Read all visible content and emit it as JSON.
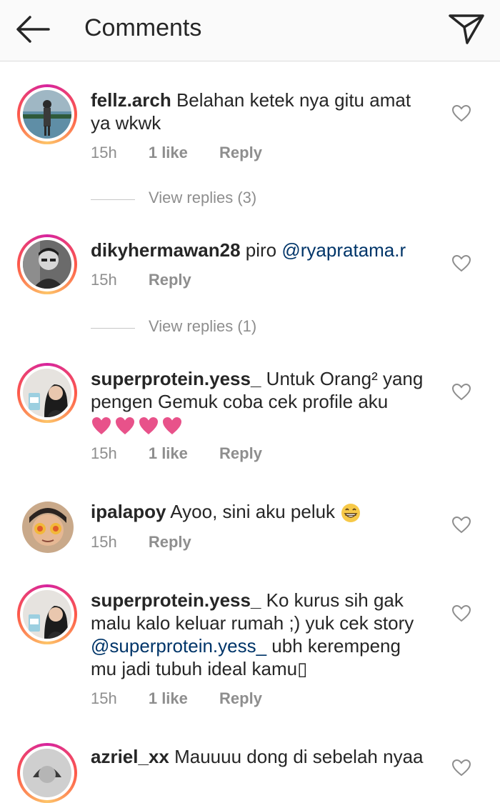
{
  "header": {
    "title": "Comments"
  },
  "comments": [
    {
      "username": "fellz.arch",
      "text_line1": " Belahan ketek nya gitu amat",
      "text_line2": "ya wkwk",
      "time": "15h",
      "likes": "1 like",
      "reply_label": "Reply",
      "view_replies": "View replies (3)"
    },
    {
      "username": "dikyhermawan28",
      "text": " piro ",
      "mention": "@ryapratama.r",
      "time": "15h",
      "reply_label": "Reply",
      "view_replies": "View replies (1)"
    },
    {
      "username": "superprotein.yess_",
      "text_line1": " Untuk Orang² yang",
      "text_line2": "pengen Gemuk coba cek profile aku",
      "time": "15h",
      "likes": "1 like",
      "reply_label": "Reply"
    },
    {
      "username": "ipalapoy",
      "text": " Ayoo, sini aku peluk ",
      "time": "15h",
      "reply_label": "Reply"
    },
    {
      "username": "superprotein.yess_",
      "text_line1": " Ko kurus sih gak",
      "text_line2": "malu kalo keluar rumah ;) yuk cek story",
      "mention": "@superprotein.yess_",
      "text_line3_rest": " ubh kerempeng",
      "text_line4": "mu jadi tubuh ideal kamu▯",
      "time": "15h",
      "likes": "1 like",
      "reply_label": "Reply"
    },
    {
      "username": "azriel_xx",
      "text": " Mauuuu dong di sebelah nyaa"
    }
  ],
  "colors": {
    "story_ring": [
      "#d6249f",
      "#fd5949",
      "#fdc468"
    ],
    "mention": "#003569",
    "meta": "#8e8e8e",
    "pink_heart": "#e8528a"
  },
  "icons": [
    "back-arrow-icon",
    "send-direct-icon",
    "heart-outline-icon",
    "pink-heart-emoji",
    "grinning-face-emoji"
  ]
}
